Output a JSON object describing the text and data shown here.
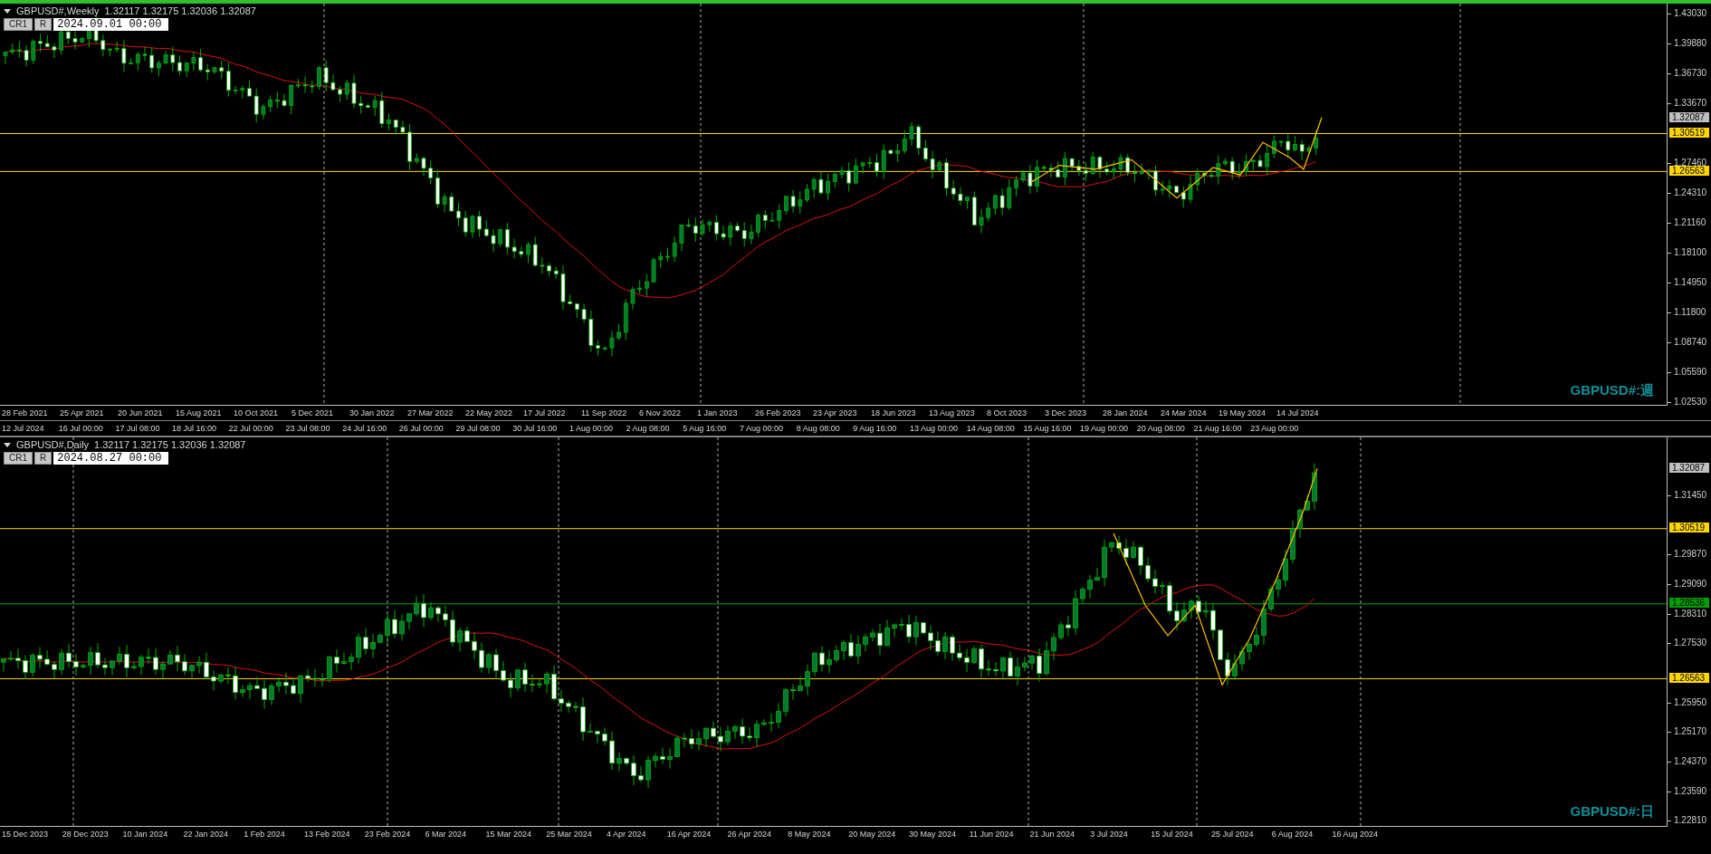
{
  "charts": [
    {
      "symbol": "GBPUSD#,Weekly",
      "ohlc": "1.32117 1.32175 1.32036 1.32087",
      "active": true,
      "buttons": [
        "CR1",
        "R"
      ],
      "date": "2024.09.01 00:00",
      "corner_label": "GBPUSD#:週",
      "price_ticks": [
        "1.43030",
        "1.39880",
        "1.36730",
        "1.33670",
        "1.27460",
        "1.24310",
        "1.21160",
        "1.18100",
        "1.14950",
        "1.11800",
        "1.08740",
        "1.05590",
        "1.02530"
      ],
      "price_labels": [
        {
          "text": "1.32087",
          "kind": "bid",
          "color": "#c0c0c0"
        },
        {
          "text": "1.30519",
          "kind": "level",
          "color": "#ffd700"
        },
        {
          "text": "1.26563",
          "kind": "level",
          "color": "#ffd700"
        }
      ],
      "time_labels": [
        "28 Feb 2021",
        "25 Apr 2021",
        "20 Jun 2021",
        "15 Aug 2021",
        "10 Oct 2021",
        "5 Dec 2021",
        "30 Jan 2022",
        "27 Mar 2022",
        "22 May 2022",
        "17 Jul 2022",
        "11 Sep 2022",
        "6 Nov 2022",
        "1 Jan 2023",
        "26 Feb 2023",
        "23 Apr 2023",
        "18 Jun 2023",
        "13 Aug 2023",
        "8 Oct 2023",
        "3 Dec 2023",
        "28 Jan 2024",
        "24 Mar 2024",
        "19 May 2024",
        "14 Jul 2024"
      ]
    },
    {
      "symbol": "GBPUSD#,Daily",
      "ohlc": "1.32117 1.32175 1.32036 1.32087",
      "active": false,
      "buttons": [
        "CR1",
        "R"
      ],
      "date": "2024.08.27 00:00",
      "corner_label": "GBPUSD#:日",
      "price_ticks": [
        "1.31450",
        "1.29870",
        "1.29090",
        "1.28310",
        "1.27530",
        "1.25950",
        "1.25170",
        "1.24370",
        "1.23590",
        "1.22810"
      ],
      "price_labels": [
        {
          "text": "1.32087",
          "kind": "bid",
          "color": "#c0c0c0"
        },
        {
          "text": "1.30519",
          "kind": "level",
          "color": "#ffd700"
        },
        {
          "text": "1.28536",
          "kind": "level",
          "color": "#00a000"
        },
        {
          "text": "1.26563",
          "kind": "level",
          "color": "#ffd700"
        }
      ],
      "time_labels": [
        "15 Dec 2023",
        "28 Dec 2023",
        "10 Jan 2024",
        "22 Jan 2024",
        "1 Feb 2024",
        "13 Feb 2024",
        "23 Feb 2024",
        "6 Mar 2024",
        "15 Mar 2024",
        "25 Mar 2024",
        "4 Apr 2024",
        "16 Apr 2024",
        "26 Apr 2024",
        "8 May 2024",
        "20 May 2024",
        "30 May 2024",
        "11 Jun 2024",
        "21 Jun 2024",
        "3 Jul 2024",
        "15 Jul 2024",
        "25 Jul 2024",
        "6 Aug 2024",
        "16 Aug 2024"
      ]
    }
  ],
  "background_time_axis": [
    "12 Jul 2024",
    "16 Jul 00:00",
    "17 Jul 08:00",
    "18 Jul 16:00",
    "22 Jul 00:00",
    "23 Jul 08:00",
    "24 Jul 16:00",
    "26 Jul 00:00",
    "29 Jul 08:00",
    "30 Jul 16:00",
    "1 Aug 00:00",
    "2 Aug 08:00",
    "5 Aug 16:00",
    "7 Aug 00:00",
    "8 Aug 08:00",
    "9 Aug 16:00",
    "13 Aug 00:00",
    "14 Aug 08:00",
    "15 Aug 16:00",
    "19 Aug 00:00",
    "20 Aug 08:00",
    "21 Aug 16:00",
    "23 Aug 00:00"
  ]
}
